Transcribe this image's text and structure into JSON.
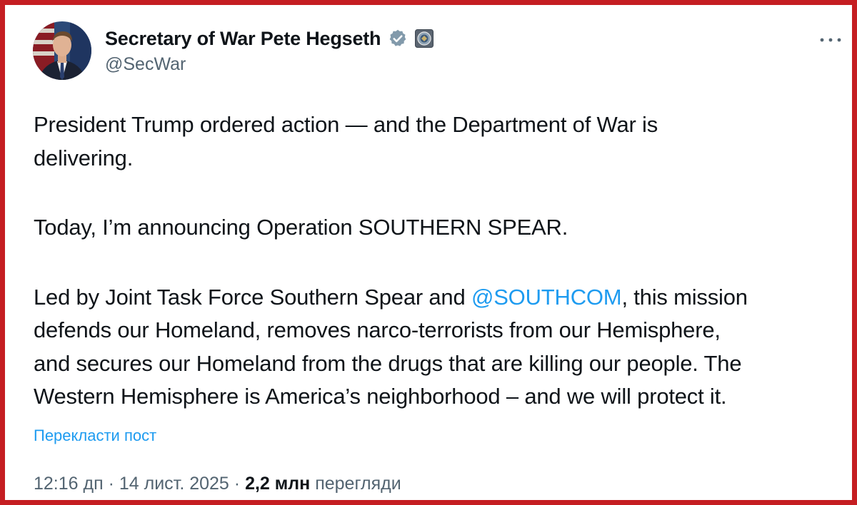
{
  "author": {
    "display_name": "Secretary of War Pete Hegseth",
    "handle": "@SecWar",
    "verified_icon": "verified-badge-icon",
    "affiliation_icon": "department-of-war-seal-icon"
  },
  "tweet": {
    "line1": "President Trump ordered action — and the Department of War is",
    "line2": "delivering.",
    "line3": "Today, I’m announcing Operation SOUTHERN SPEAR.",
    "line4_pre": "Led by Joint Task Force Southern Spear and ",
    "mention": "@SOUTHCOM",
    "line4_post": ", this mission",
    "line5": "defends our Homeland, removes narco-terrorists from our Hemisphere,",
    "line6": "and secures our Homeland from the drugs that are killing our people. The",
    "line7": "Western Hemisphere is America’s neighborhood – and we will protect it."
  },
  "translate_label": "Перекласти пост",
  "meta": {
    "timestamp": "12:16 дп · 14 лист. 2025 · ",
    "views_count": "2,2 млн",
    "views_label": " перегляди"
  },
  "colors": {
    "frame": "#c51e22",
    "accent": "#1d9bf0",
    "text": "#0f1419",
    "secondary": "#536471"
  }
}
